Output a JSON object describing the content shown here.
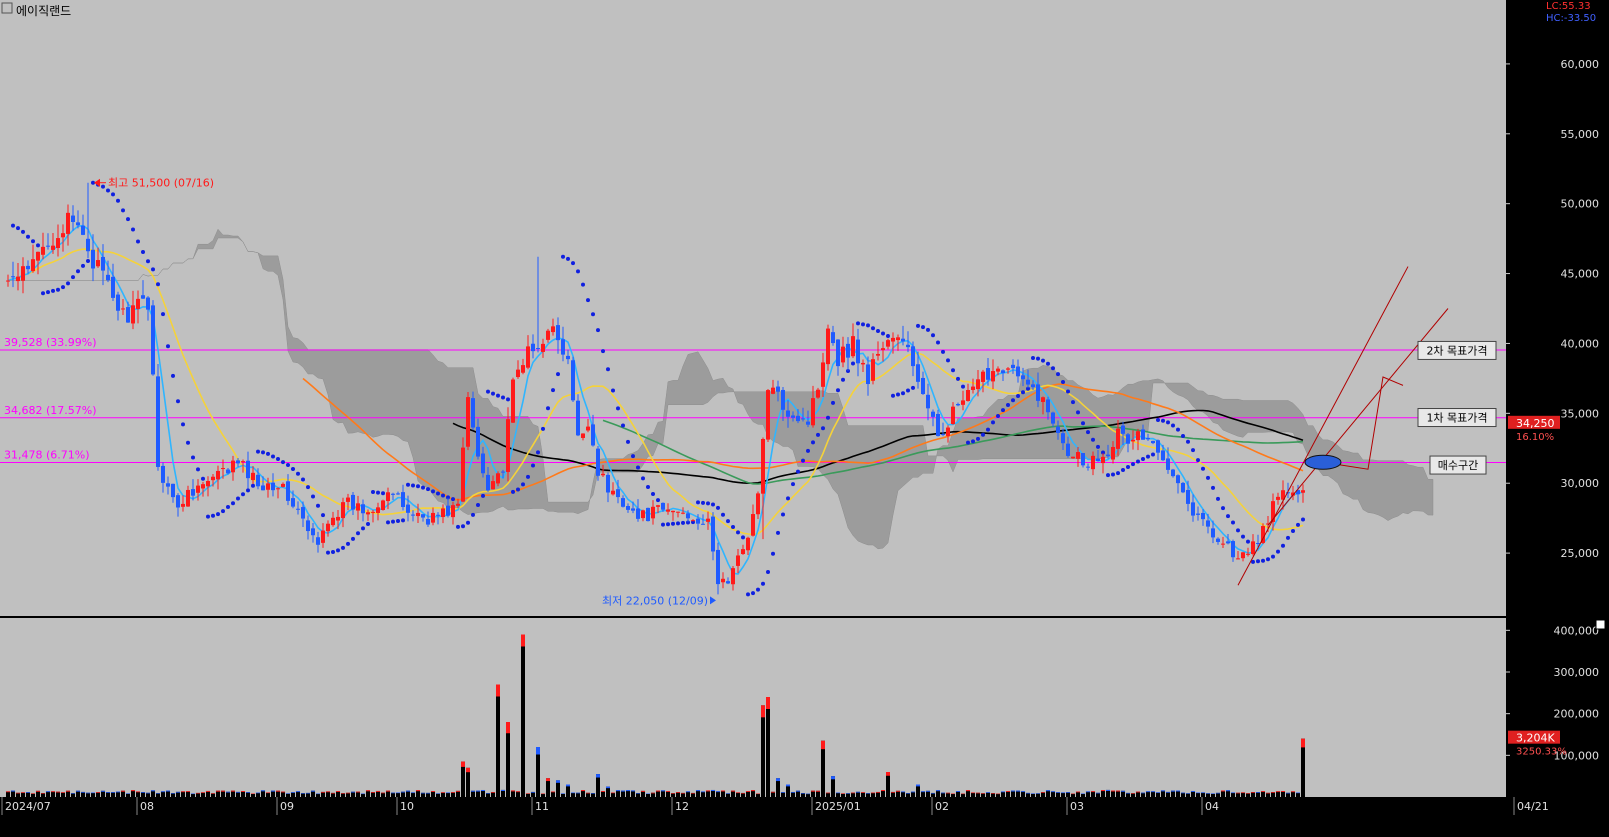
{
  "title": "에이직랜드",
  "lc_label": "LC:55.33",
  "hc_label": "HC:-33.50",
  "colors": {
    "bg": "#c0c0c0",
    "axis_bg": "#000000",
    "up": "#ff1a1a",
    "down": "#1f5bff",
    "ma5": "#2fb5ff",
    "ma20": "#f5d23a",
    "ma60": "#ff7a1a",
    "ma120": "#3a9a5a",
    "ma240": "#000000",
    "psar": "#1020e0",
    "cloud": "#999999",
    "target": "#ff00ff",
    "channel": "#b00000"
  },
  "chart_data": {
    "type": "candlestick",
    "price_axis": {
      "ticks": [
        "60,000",
        "55,000",
        "50,000",
        "45,000",
        "40,000",
        "35,000",
        "30,000",
        "25,000"
      ],
      "ylim": [
        20500,
        64000
      ]
    },
    "volume_axis": {
      "ticks": [
        "400,000",
        "300,000",
        "200,000",
        "100,000"
      ],
      "ylim": [
        0,
        420000
      ]
    },
    "x_axis": {
      "labels": [
        "2024/07",
        "08",
        "09",
        "10",
        "11",
        "12",
        "2025/01",
        "02",
        "03",
        "04",
        "04/21"
      ]
    },
    "annotations": {
      "high": "최고 51,500 (07/16)",
      "low": "최저 22,050 (12/09)"
    },
    "levels": [
      {
        "value": 39528,
        "label": "39,528 (33.99%)"
      },
      {
        "value": 34682,
        "label": "34,682 (17.57%)"
      },
      {
        "value": 31478,
        "label": "31,478 (6.71%)"
      }
    ],
    "targets": [
      {
        "label": "2차 목표가격",
        "value": 39500
      },
      {
        "label": "1차 목표가격",
        "value": 34700
      },
      {
        "label": "매수구간",
        "value": 31300
      }
    ],
    "last_price": {
      "value": 34250,
      "label": "34,250",
      "change": "16.10%"
    },
    "last_volume": {
      "label": "3,204K",
      "change": "3250.33%"
    },
    "anchors": [
      [
        0,
        44500
      ],
      [
        4,
        45000
      ],
      [
        8,
        47500
      ],
      [
        12,
        48500
      ],
      [
        15,
        48000
      ],
      [
        17,
        46000
      ],
      [
        20,
        44000
      ],
      [
        23,
        42000
      ],
      [
        26,
        42500
      ],
      [
        28,
        43000
      ],
      [
        29,
        38000
      ],
      [
        30,
        31000
      ],
      [
        32,
        30000
      ],
      [
        34,
        28000
      ],
      [
        36,
        29500
      ],
      [
        40,
        30000
      ],
      [
        44,
        31000
      ],
      [
        46,
        31500
      ],
      [
        50,
        30000
      ],
      [
        54,
        30000
      ],
      [
        58,
        28000
      ],
      [
        60,
        26500
      ],
      [
        62,
        25500
      ],
      [
        64,
        27500
      ],
      [
        68,
        28500
      ],
      [
        72,
        28000
      ],
      [
        76,
        29500
      ],
      [
        80,
        28000
      ],
      [
        84,
        27500
      ],
      [
        88,
        28000
      ],
      [
        90,
        28500
      ],
      [
        92,
        36000
      ],
      [
        94,
        32000
      ],
      [
        96,
        30000
      ],
      [
        99,
        31000
      ],
      [
        101,
        37000
      ],
      [
        103,
        39000
      ],
      [
        106,
        39500
      ],
      [
        108,
        41500
      ],
      [
        110,
        40000
      ],
      [
        112,
        38500
      ],
      [
        114,
        33000
      ],
      [
        116,
        34500
      ],
      [
        118,
        31000
      ],
      [
        120,
        29500
      ],
      [
        122,
        29000
      ],
      [
        124,
        28500
      ],
      [
        126,
        27500
      ],
      [
        130,
        28000
      ],
      [
        134,
        28000
      ],
      [
        138,
        27500
      ],
      [
        140,
        27000
      ],
      [
        142,
        23000
      ],
      [
        144,
        23000
      ],
      [
        146,
        24500
      ],
      [
        148,
        26500
      ],
      [
        150,
        29000
      ],
      [
        152,
        37000
      ],
      [
        154,
        36000
      ],
      [
        157,
        35000
      ],
      [
        160,
        34500
      ],
      [
        162,
        37000
      ],
      [
        164,
        41500
      ],
      [
        166,
        39000
      ],
      [
        169,
        40000
      ],
      [
        172,
        37500
      ],
      [
        174,
        39500
      ],
      [
        177,
        40500
      ],
      [
        180,
        39500
      ],
      [
        182,
        37500
      ],
      [
        184,
        35000
      ],
      [
        186,
        33500
      ],
      [
        188,
        34500
      ],
      [
        190,
        35500
      ],
      [
        193,
        36500
      ],
      [
        196,
        38000
      ],
      [
        199,
        38500
      ],
      [
        201,
        38000
      ],
      [
        203,
        37000
      ],
      [
        206,
        36500
      ],
      [
        208,
        35000
      ],
      [
        210,
        34000
      ],
      [
        212,
        32500
      ],
      [
        214,
        32000
      ],
      [
        216,
        31500
      ],
      [
        218,
        32000
      ],
      [
        220,
        32500
      ],
      [
        222,
        33500
      ],
      [
        224,
        33000
      ],
      [
        226,
        33500
      ],
      [
        228,
        33000
      ],
      [
        230,
        32000
      ],
      [
        232,
        31500
      ],
      [
        234,
        30500
      ],
      [
        236,
        28500
      ],
      [
        238,
        27500
      ],
      [
        240,
        27000
      ],
      [
        242,
        26000
      ],
      [
        244,
        25500
      ],
      [
        246,
        24500
      ],
      [
        248,
        25000
      ],
      [
        250,
        26000
      ],
      [
        252,
        27500
      ],
      [
        254,
        29000
      ],
      [
        256,
        29500
      ],
      [
        258,
        29000
      ],
      [
        259,
        29500
      ],
      [
        260,
        34250
      ]
    ]
  }
}
